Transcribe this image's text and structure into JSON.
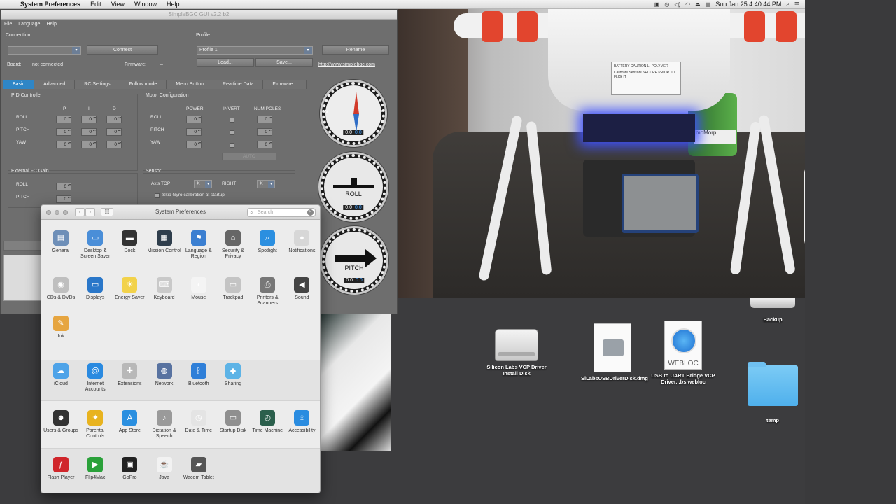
{
  "menubar": {
    "app": "System Preferences",
    "items": [
      "Edit",
      "View",
      "Window",
      "Help"
    ],
    "clock": "Sun Jan 25  4:40:44 PM",
    "colors": {
      "bar": "#e6e6e6"
    }
  },
  "bgc": {
    "title": "SimpleBGC GUI v2.2 b2",
    "menu": [
      "File",
      "Language",
      "Help"
    ],
    "connection_label": "Connection",
    "connect_btn": "Connect",
    "board_label": "Board:",
    "board_value": "not connected",
    "firmware_label": "Firmware:",
    "firmware_value": "–",
    "profile_label": "Profile",
    "profile_value": "Profile 1",
    "load_btn": "Load...",
    "save_btn": "Save...",
    "rename_btn": "Rename",
    "link": "http://www.simplebgc.com",
    "tabs": [
      "Basic",
      "Advanced",
      "RC Settings",
      "Follow mode",
      "Menu Button",
      "Realtime Data",
      "Firmware..."
    ],
    "pid_title": "PID Controller",
    "pid_cols": [
      "P",
      "I",
      "D"
    ],
    "axes": [
      "ROLL",
      "PITCH",
      "YAW"
    ],
    "spin_value": "0",
    "motor_title": "Motor Configuration",
    "motor_cols": [
      "POWER",
      "INVERT",
      "NUM.POLES"
    ],
    "auto_btn": "AUTO",
    "ext_title": "External FC Gain",
    "ext_axes": [
      "ROLL",
      "PITCH"
    ],
    "sensor_title": "Sensor",
    "axis_top_label": "Axis TOP",
    "axis_top_value": "X",
    "right_label": "RIGHT",
    "right_value": "X",
    "skip_gyro": "Skip Gyro calibration at startup",
    "gauges": {
      "compass": {
        "w": "W",
        "e": "E",
        "val": "0.0",
        "val2": "0.0"
      },
      "roll": {
        "word": "ROLL",
        "val": "0.0",
        "val2": "0.0"
      },
      "pitch": {
        "word": "PITCH",
        "val": "0.0",
        "val2": "0.0"
      }
    }
  },
  "photo": {
    "label_text": "BATTERY CAUTION LI-POLYMER",
    "label_text2": "Calibrate Sensors SECURE PRIOR TO FLIGHT",
    "can_text": "moMorp"
  },
  "desktop": {
    "items": [
      {
        "label": "Silicon Labs VCP Driver Install Disk",
        "icon": "hard-drive-icon"
      },
      {
        "label": "SiLabsUSBDriverDisk.dmg",
        "icon": "disk-image-icon"
      },
      {
        "label": "USB to UART Bridge VCP Driver...bs.webloc",
        "icon": "webloc-icon",
        "badge": "WEBLOC"
      },
      {
        "label": "Backup",
        "icon": "mac-mini-icon"
      },
      {
        "label": "temp",
        "icon": "folder-icon"
      }
    ]
  },
  "sysprefs": {
    "title": "System Preferences",
    "search_placeholder": "Search",
    "row1": [
      {
        "label": "General",
        "color": "#6e8fb8",
        "glyph": "▤"
      },
      {
        "label": "Desktop & Screen Saver",
        "color": "#4a8ed8",
        "glyph": "▭"
      },
      {
        "label": "Dock",
        "color": "#333333",
        "glyph": "▬"
      },
      {
        "label": "Mission Control",
        "color": "#2f3e4c",
        "glyph": "▦"
      },
      {
        "label": "Language & Region",
        "color": "#3b7fd1",
        "glyph": "⚑"
      },
      {
        "label": "Security & Privacy",
        "color": "#666666",
        "glyph": "⌂"
      },
      {
        "label": "Spotlight",
        "color": "#2b8fe0",
        "glyph": "⌕"
      },
      {
        "label": "Notifications",
        "color": "#d7d7d7",
        "glyph": "●"
      }
    ],
    "row2": [
      {
        "label": "CDs & DVDs",
        "color": "#bfbfbf",
        "glyph": "◉"
      },
      {
        "label": "Displays",
        "color": "#2a77c9",
        "glyph": "▭"
      },
      {
        "label": "Energy Saver",
        "color": "#f2d24a",
        "glyph": "☀"
      },
      {
        "label": "Keyboard",
        "color": "#c9c9c9",
        "glyph": "⌨"
      },
      {
        "label": "Mouse",
        "color": "#f4f4f4",
        "glyph": "◖"
      },
      {
        "label": "Trackpad",
        "color": "#c4c4c4",
        "glyph": "▭"
      },
      {
        "label": "Printers & Scanners",
        "color": "#777777",
        "glyph": "⎙"
      },
      {
        "label": "Sound",
        "color": "#444444",
        "glyph": "◀"
      }
    ],
    "row3": [
      {
        "label": "Ink",
        "color": "#e6a540",
        "glyph": "✎"
      }
    ],
    "row4": [
      {
        "label": "iCloud",
        "color": "#4ea3e8",
        "glyph": "☁"
      },
      {
        "label": "Internet Accounts",
        "color": "#2a8ae0",
        "glyph": "@"
      },
      {
        "label": "Extensions",
        "color": "#b8b8b8",
        "glyph": "✚"
      },
      {
        "label": "Network",
        "color": "#5872a0",
        "glyph": "◍"
      },
      {
        "label": "Bluetooth",
        "color": "#2f7fd8",
        "glyph": "ᛒ"
      },
      {
        "label": "Sharing",
        "color": "#5db3e6",
        "glyph": "◆"
      }
    ],
    "row5": [
      {
        "label": "Users & Groups",
        "color": "#333333",
        "glyph": "☻"
      },
      {
        "label": "Parental Controls",
        "color": "#e8b31f",
        "glyph": "✦"
      },
      {
        "label": "App Store",
        "color": "#2a8fe0",
        "glyph": "A"
      },
      {
        "label": "Dictation & Speech",
        "color": "#9a9a9a",
        "glyph": "♪"
      },
      {
        "label": "Date & Time",
        "color": "#e4e4e4",
        "glyph": "◷"
      },
      {
        "label": "Startup Disk",
        "color": "#8f8f8f",
        "glyph": "▭"
      },
      {
        "label": "Time Machine",
        "color": "#2b5f4c",
        "glyph": "◴"
      },
      {
        "label": "Accessibility",
        "color": "#2a8ce0",
        "glyph": "☺"
      }
    ],
    "row6": [
      {
        "label": "Flash Player",
        "color": "#d0262b",
        "glyph": "ƒ"
      },
      {
        "label": "Flip4Mac",
        "color": "#2aa13a",
        "glyph": "▶"
      },
      {
        "label": "GoPro",
        "color": "#222222",
        "glyph": "▣"
      },
      {
        "label": "Java",
        "color": "#f2f2f2",
        "glyph": "☕"
      },
      {
        "label": "Wacom Tablet",
        "color": "#555555",
        "glyph": "▰"
      }
    ]
  }
}
